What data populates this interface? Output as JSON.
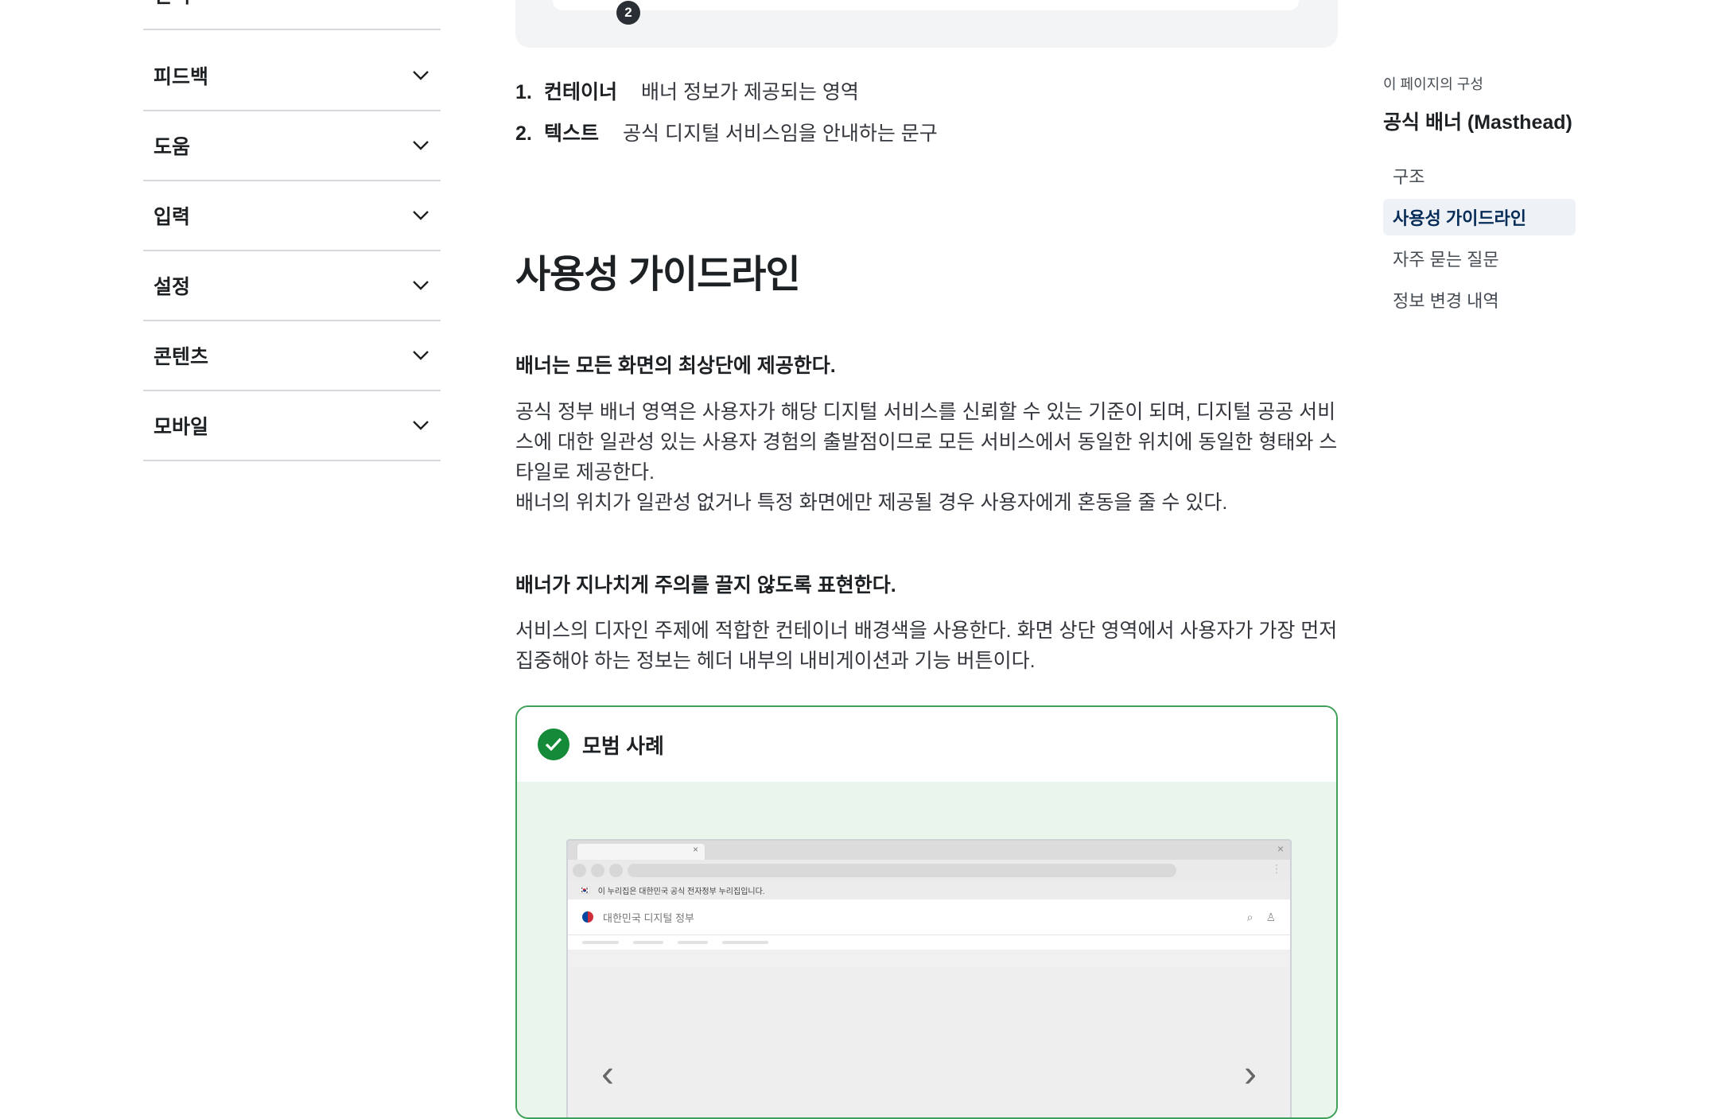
{
  "sidebar": {
    "items": [
      {
        "label": "선택"
      },
      {
        "label": "피드백"
      },
      {
        "label": "도움"
      },
      {
        "label": "입력"
      },
      {
        "label": "설정"
      },
      {
        "label": "콘텐츠"
      },
      {
        "label": "모바일"
      }
    ]
  },
  "structure": {
    "marker_number": "2",
    "items": [
      {
        "index": "1.",
        "term": "컨테이너",
        "desc": "배너 정보가 제공되는 영역"
      },
      {
        "index": "2.",
        "term": "텍스트",
        "desc": "공식 디지털 서비스임을 안내하는 문구"
      }
    ]
  },
  "section": {
    "title": "사용성 가이드라인",
    "guide1": {
      "heading": "배너는 모든 화면의 최상단에 제공한다.",
      "para1": "공식 정부 배너 영역은 사용자가 해당 디지털 서비스를 신뢰할 수 있는 기준이 되며, 디지털 공공 서비스에 대한 일관성 있는 사용자 경험의 출발점이므로 모든 서비스에서 동일한 위치에 동일한 형태와 스타일로 제공한다.",
      "para2": "배너의 위치가 일관성 없거나 특정 화면에만 제공될 경우 사용자에게 혼동을 줄 수 있다."
    },
    "guide2": {
      "heading": "배너가 지나치게 주의를 끌지 않도록 표현한다.",
      "para": "서비스의 디자인 주제에 적합한 컨테이너 배경색을 사용한다. 화면 상단 영역에서 사용자가 가장 먼저 집중해야 하는 정보는 헤더 내부의 내비게이션과 기능 버튼이다."
    }
  },
  "example": {
    "title": "모범 사례",
    "masthead_text": "이 누리집은 대한민국 공식 전자정부 누리집입니다.",
    "site_name": "대한민국 디지털 정부",
    "tab_close": "×",
    "window_close": "×",
    "menu_glyph": "⋮",
    "flag_glyph": "🇰🇷",
    "search_glyph": "⌕",
    "user_glyph": "♙",
    "prev_glyph": "‹",
    "next_glyph": "›"
  },
  "toc": {
    "caption": "이 페이지의 구성",
    "title": "공식 배너 (Masthead)",
    "items": [
      {
        "label": "구조"
      },
      {
        "label": "사용성 가이드라인"
      },
      {
        "label": "자주 묻는 질문"
      },
      {
        "label": "정보 변경 내역"
      }
    ]
  },
  "colors": {
    "good_example_border": "#3fa05a",
    "good_example_bg": "#eaf5ec",
    "check_badge": "#158a38",
    "toc_active_bg": "#eef2f7"
  }
}
